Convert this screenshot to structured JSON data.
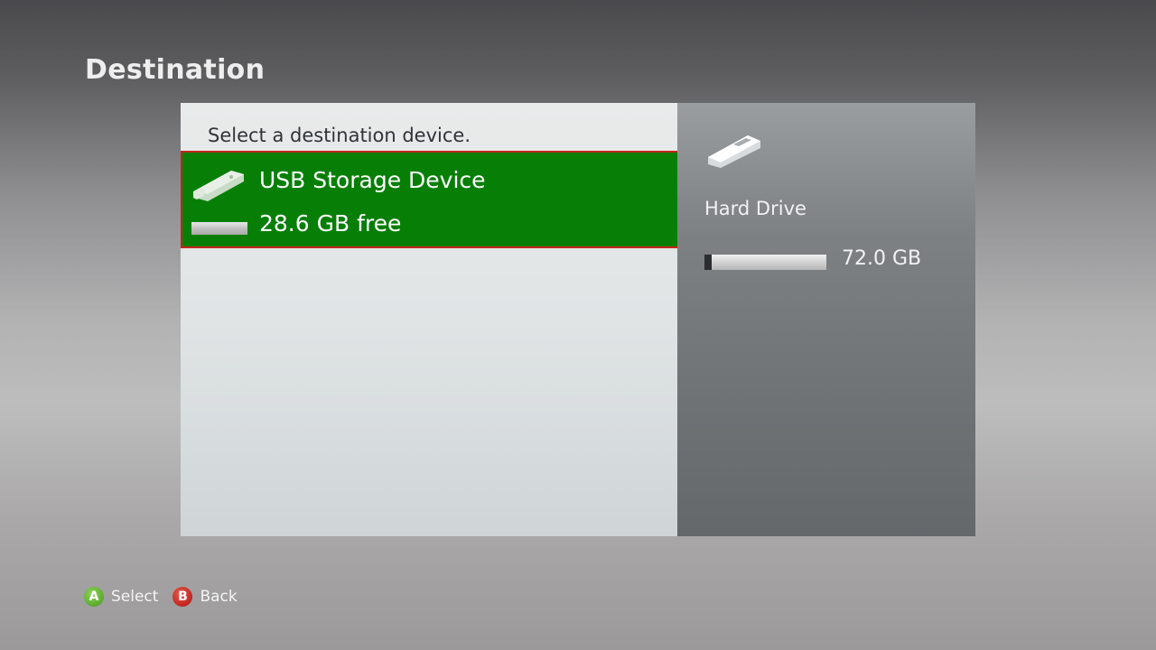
{
  "page": {
    "title": "Destination"
  },
  "list": {
    "prompt": "Select a destination device.",
    "items": [
      {
        "icon": "usb-drive-icon",
        "name": "USB Storage Device",
        "free": "28.6 GB free",
        "selected": true,
        "used_fraction": 0.0
      }
    ]
  },
  "details": {
    "icon": "hard-drive-icon",
    "name": "Hard Drive",
    "size": "72.0 GB",
    "used_fraction": 0.06
  },
  "footer": {
    "hints": [
      {
        "glyph": "A",
        "label": "Select",
        "color": "#5aab2c"
      },
      {
        "glyph": "B",
        "label": "Back",
        "color": "#c2261d"
      }
    ]
  },
  "colors": {
    "selection_fill": "#077f07",
    "selection_border": "#c8231d"
  }
}
